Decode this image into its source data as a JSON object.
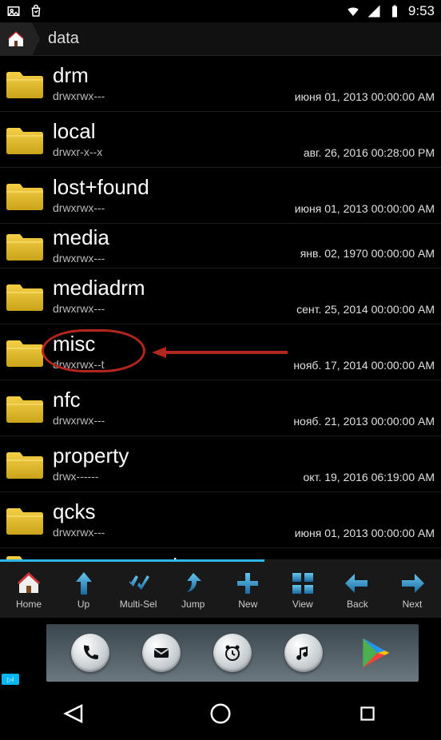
{
  "status": {
    "time": "9:53"
  },
  "breadcrumb": {
    "path": "data"
  },
  "files": [
    {
      "name": "drm",
      "perm": "drwxrwx---",
      "date": "июня 01, 2013 00:00:00 AM"
    },
    {
      "name": "local",
      "perm": "drwxr-x--x",
      "date": "авг. 26, 2016 00:28:00 PM"
    },
    {
      "name": "lost+found",
      "perm": "drwxrwx---",
      "date": "июня 01, 2013 00:00:00 AM"
    },
    {
      "name": "media",
      "perm": "drwxrwx---",
      "date": "янв. 02, 1970 00:00:00 AM"
    },
    {
      "name": "mediadrm",
      "perm": "drwxrwx---",
      "date": "сент. 25, 2014 00:00:00 AM"
    },
    {
      "name": "misc",
      "perm": "drwxrwx--t",
      "date": "нояб. 17, 2014 00:00:00 AM",
      "highlighted": true
    },
    {
      "name": "nfc",
      "perm": "drwxrwx---",
      "date": "нояб. 21, 2013 00:00:00 AM"
    },
    {
      "name": "property",
      "perm": "drwx------",
      "date": "окт. 19, 2016 06:19:00 AM"
    },
    {
      "name": "qcks",
      "perm": "drwxrwx---",
      "date": "июня 01, 2013 00:00:00 AM"
    },
    {
      "name": "resource-cache",
      "perm": "",
      "date": ""
    }
  ],
  "toolbar": [
    {
      "id": "home",
      "label": "Home"
    },
    {
      "id": "up",
      "label": "Up"
    },
    {
      "id": "multisel",
      "label": "Multi-Sel"
    },
    {
      "id": "jump",
      "label": "Jump"
    },
    {
      "id": "new",
      "label": "New"
    },
    {
      "id": "view",
      "label": "View"
    },
    {
      "id": "back",
      "label": "Back"
    },
    {
      "id": "next",
      "label": "Next"
    }
  ],
  "adchoice_label": "i",
  "colors": {
    "accent": "#2bb8e6",
    "toolbar_icon": "#1f6fa8",
    "toolbar_icon_light": "#5fc0e8",
    "highlight_red": "#b3261e"
  }
}
